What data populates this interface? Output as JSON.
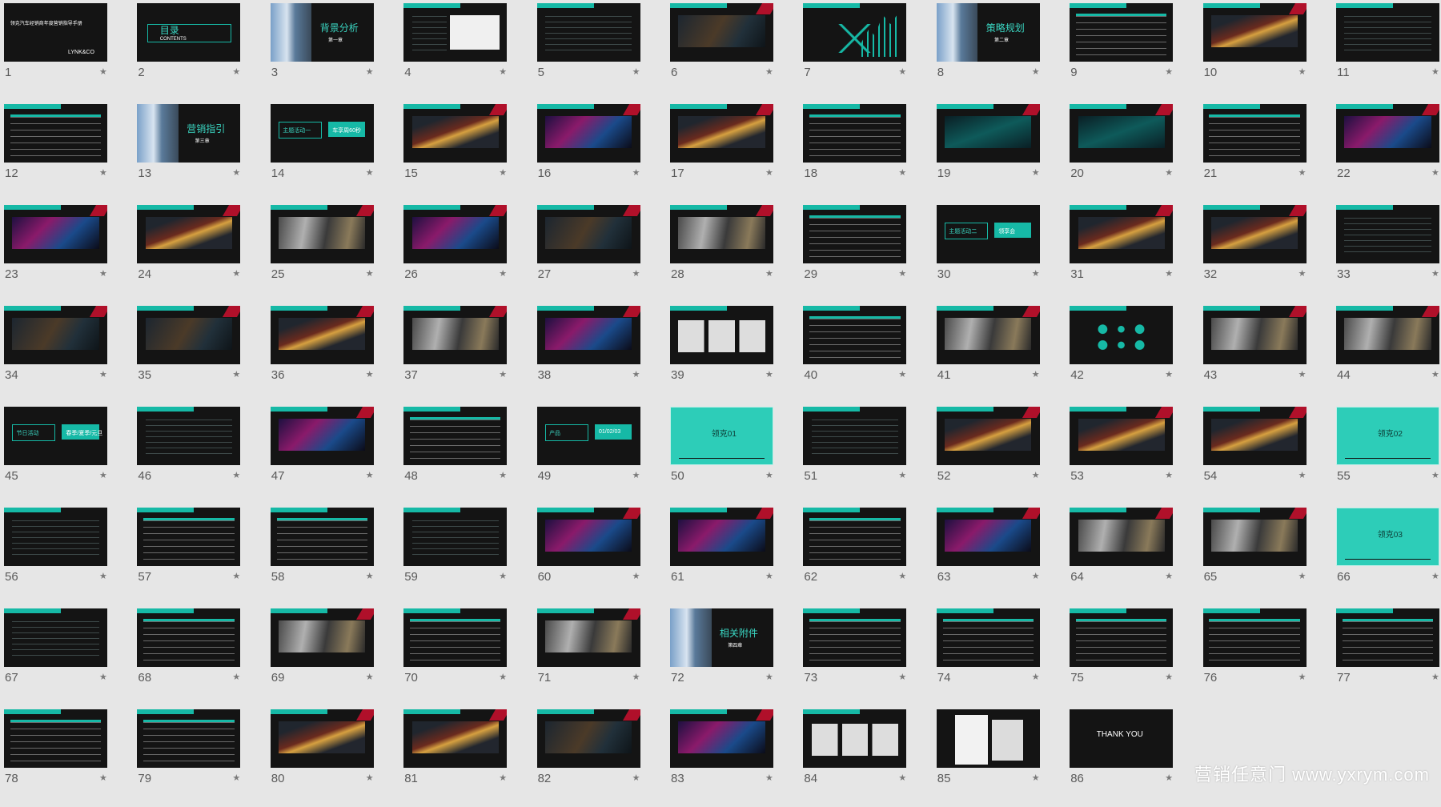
{
  "colors": {
    "background": "#e6e6e6",
    "accent": "#16b9a6",
    "thumb_dark": "#141414",
    "teal_slide": "#2dcdb8"
  },
  "star_icon": "★",
  "watermark": "营销任意门 www.yxrym.com",
  "slides": [
    {
      "num": "1",
      "style": "title",
      "lines": [
        "领克汽车经销商年度营销指导手册",
        "LYNK&CO"
      ]
    },
    {
      "num": "2",
      "style": "agenda",
      "lines": [
        "目录",
        "CONTENTS"
      ]
    },
    {
      "num": "3",
      "style": "section",
      "lines": [
        "背景分析",
        "第一章"
      ]
    },
    {
      "num": "4",
      "style": "chart"
    },
    {
      "num": "5",
      "style": "lines"
    },
    {
      "num": "6",
      "style": "city"
    },
    {
      "num": "7",
      "style": "mountain"
    },
    {
      "num": "8",
      "style": "section",
      "lines": [
        "策略规划",
        "第二章"
      ]
    },
    {
      "num": "9",
      "style": "table"
    },
    {
      "num": "10",
      "style": "car"
    },
    {
      "num": "11",
      "style": "lines"
    },
    {
      "num": "12",
      "style": "table"
    },
    {
      "num": "13",
      "style": "section",
      "lines": [
        "营销指引",
        "第三章"
      ]
    },
    {
      "num": "14",
      "style": "buttons",
      "lines": [
        "主题活动一",
        "车享周60秒"
      ]
    },
    {
      "num": "15",
      "style": "car"
    },
    {
      "num": "16",
      "style": "neon"
    },
    {
      "num": "17",
      "style": "car"
    },
    {
      "num": "18",
      "style": "table"
    },
    {
      "num": "19",
      "style": "cyan"
    },
    {
      "num": "20",
      "style": "cyan"
    },
    {
      "num": "21",
      "style": "table"
    },
    {
      "num": "22",
      "style": "neon"
    },
    {
      "num": "23",
      "style": "neon"
    },
    {
      "num": "24",
      "style": "car"
    },
    {
      "num": "25",
      "style": "photo"
    },
    {
      "num": "26",
      "style": "neon"
    },
    {
      "num": "27",
      "style": "city"
    },
    {
      "num": "28",
      "style": "photo"
    },
    {
      "num": "29",
      "style": "table"
    },
    {
      "num": "30",
      "style": "buttons",
      "lines": [
        "主题活动二",
        "领享会"
      ]
    },
    {
      "num": "31",
      "style": "car"
    },
    {
      "num": "32",
      "style": "car"
    },
    {
      "num": "33",
      "style": "lines"
    },
    {
      "num": "34",
      "style": "city"
    },
    {
      "num": "35",
      "style": "city"
    },
    {
      "num": "36",
      "style": "car"
    },
    {
      "num": "37",
      "style": "photo"
    },
    {
      "num": "38",
      "style": "neon"
    },
    {
      "num": "39",
      "style": "people"
    },
    {
      "num": "40",
      "style": "table"
    },
    {
      "num": "41",
      "style": "photo"
    },
    {
      "num": "42",
      "style": "circles"
    },
    {
      "num": "43",
      "style": "photo"
    },
    {
      "num": "44",
      "style": "photo"
    },
    {
      "num": "45",
      "style": "buttons",
      "lines": [
        "节日活动",
        "春季/夏季/元旦"
      ]
    },
    {
      "num": "46",
      "style": "lines"
    },
    {
      "num": "47",
      "style": "neon"
    },
    {
      "num": "48",
      "style": "table"
    },
    {
      "num": "49",
      "style": "buttons",
      "lines": [
        "产品",
        "01/02/03"
      ]
    },
    {
      "num": "50",
      "style": "teal",
      "lines": [
        "领克01"
      ]
    },
    {
      "num": "51",
      "style": "lines"
    },
    {
      "num": "52",
      "style": "car"
    },
    {
      "num": "53",
      "style": "car"
    },
    {
      "num": "54",
      "style": "car"
    },
    {
      "num": "55",
      "style": "teal",
      "lines": [
        "领克02"
      ]
    },
    {
      "num": "56",
      "style": "lines"
    },
    {
      "num": "57",
      "style": "table"
    },
    {
      "num": "58",
      "style": "table"
    },
    {
      "num": "59",
      "style": "lines"
    },
    {
      "num": "60",
      "style": "neon"
    },
    {
      "num": "61",
      "style": "neon"
    },
    {
      "num": "62",
      "style": "table"
    },
    {
      "num": "63",
      "style": "neon"
    },
    {
      "num": "64",
      "style": "photo"
    },
    {
      "num": "65",
      "style": "photo"
    },
    {
      "num": "66",
      "style": "teal",
      "lines": [
        "领克03"
      ]
    },
    {
      "num": "67",
      "style": "lines"
    },
    {
      "num": "68",
      "style": "table"
    },
    {
      "num": "69",
      "style": "photo"
    },
    {
      "num": "70",
      "style": "table"
    },
    {
      "num": "71",
      "style": "photo"
    },
    {
      "num": "72",
      "style": "section",
      "lines": [
        "相关附件",
        "第四章"
      ]
    },
    {
      "num": "73",
      "style": "table"
    },
    {
      "num": "74",
      "style": "table"
    },
    {
      "num": "75",
      "style": "table"
    },
    {
      "num": "76",
      "style": "table"
    },
    {
      "num": "77",
      "style": "table"
    },
    {
      "num": "78",
      "style": "table"
    },
    {
      "num": "79",
      "style": "table"
    },
    {
      "num": "80",
      "style": "car"
    },
    {
      "num": "81",
      "style": "car"
    },
    {
      "num": "82",
      "style": "city"
    },
    {
      "num": "83",
      "style": "neon"
    },
    {
      "num": "84",
      "style": "people"
    },
    {
      "num": "85",
      "style": "docs"
    },
    {
      "num": "86",
      "style": "thanks",
      "lines": [
        "THANK YOU"
      ]
    }
  ]
}
